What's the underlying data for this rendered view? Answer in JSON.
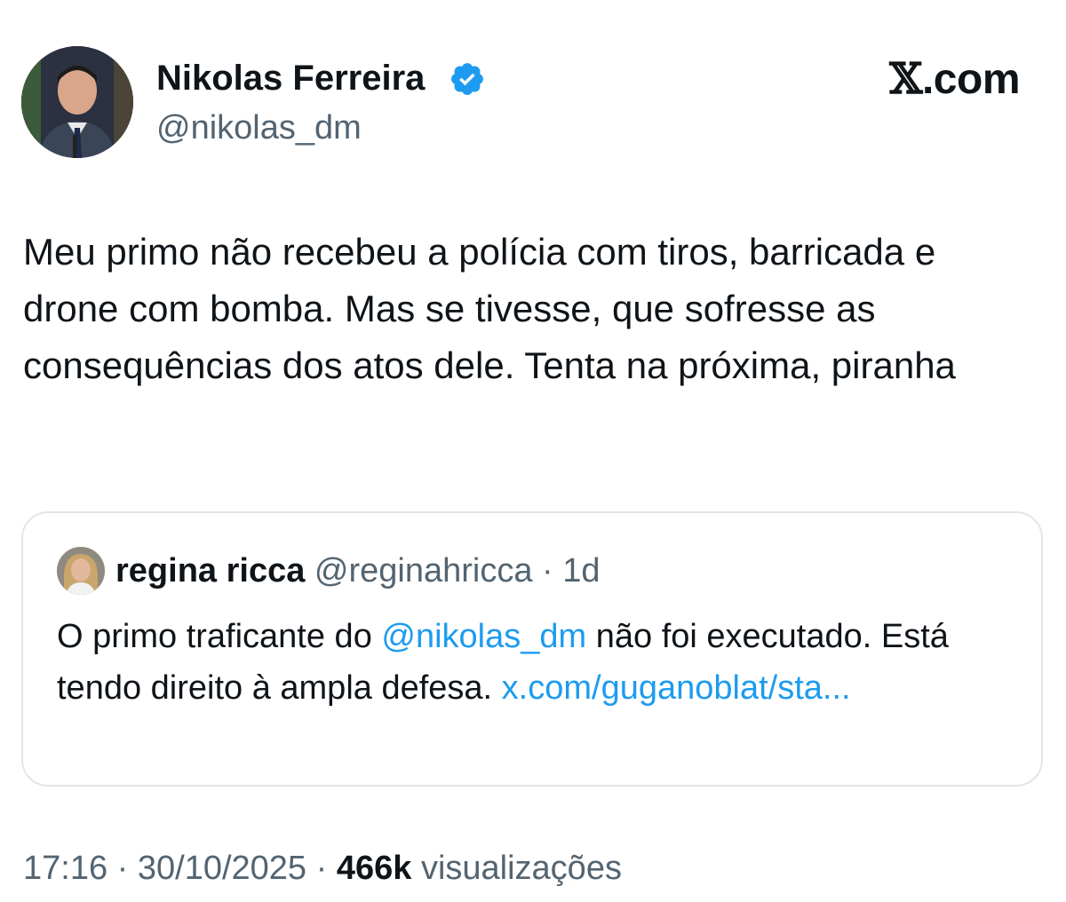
{
  "author": {
    "display_name": "Nikolas Ferreira",
    "handle": "@nikolas_dm",
    "verified_icon": "verified-badge-icon",
    "verified_color": "#1d9bf0"
  },
  "brand": {
    "label": ".com",
    "x_glyph": "𝕏"
  },
  "tweet": {
    "text": "Meu primo não recebeu a polícia com tiros, barricada e drone com bomba. Mas se tivesse, que sofresse as consequências dos atos dele. Tenta na próxima, piranha"
  },
  "quoted": {
    "display_name": "regina ricca",
    "handle": "@reginahricca",
    "separator": "·",
    "time": "1d",
    "text_before_mention": "O primo traficante do ",
    "mention": "@nikolas_dm",
    "text_after_mention": " não foi executado. Está tendo direito à ampla defesa. ",
    "link": "x.com/guganoblat/sta..."
  },
  "footer": {
    "time": "17:16",
    "date": "30/10/2025",
    "separator": "·",
    "views_count": "466k",
    "views_label": "visualizações"
  },
  "colors": {
    "text": "#0f1419",
    "muted": "#536471",
    "link": "#1d9bf0",
    "border": "#e1e6ea"
  }
}
